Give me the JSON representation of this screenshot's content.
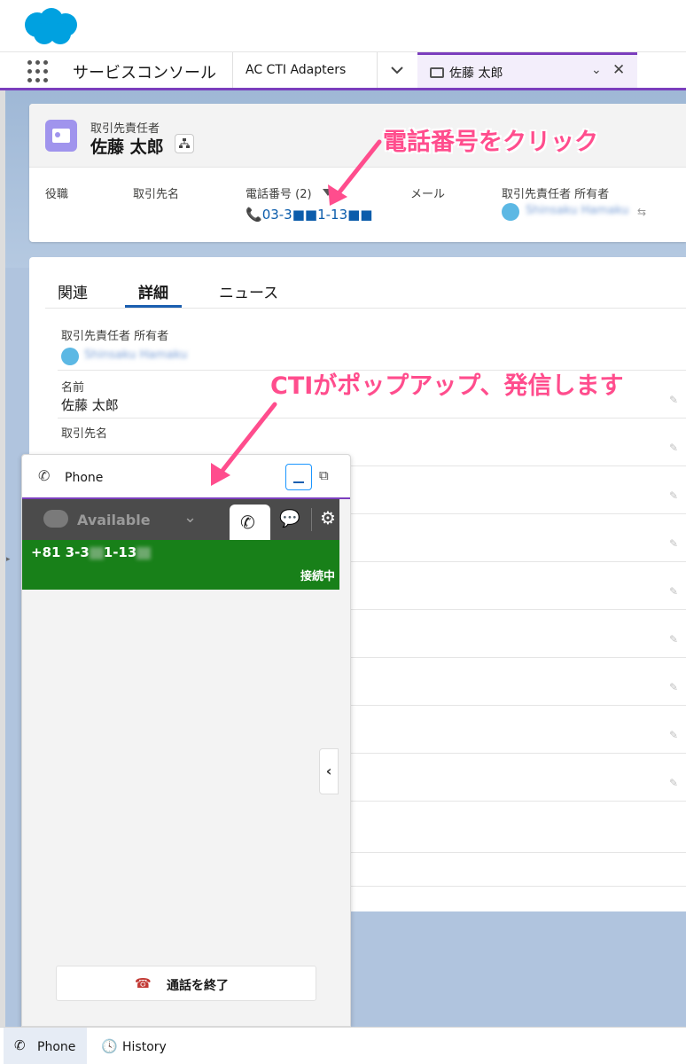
{
  "header": {
    "app_name": "サービスコンソール",
    "tabs": [
      {
        "label": "AC CTI Adapters"
      },
      {
        "label": "佐藤 太郎"
      }
    ]
  },
  "record": {
    "type_label": "取引先責任者",
    "name": "佐藤 太郎",
    "highlights": {
      "title_label": "役職",
      "account_label": "取引先名",
      "phone_label": "電話番号 (2)",
      "phone_value": "03-3■■1-13■■",
      "email_label": "メール",
      "owner_label": "取引先責任者 所有者",
      "owner_value": "Shinsaku Hamaku"
    }
  },
  "detail": {
    "tabs": [
      "関連",
      "詳細",
      "ニュース"
    ],
    "active_tab": "詳細",
    "fields": [
      {
        "label": "取引先責任者 所有者",
        "value": "Shinsaku Hamaku"
      },
      {
        "label": "名前",
        "value": "佐藤 太郎"
      },
      {
        "label": "取引先名",
        "value": ""
      }
    ]
  },
  "phone_panel": {
    "title": "Phone",
    "status": "Available",
    "call_number": "+81 3-3",
    "call_number_mid": "1-13",
    "call_status": "接続中",
    "end_call_label": "通話を終了"
  },
  "utility_bar": {
    "items": [
      {
        "label": "Phone"
      },
      {
        "label": "History"
      }
    ]
  },
  "annotations": {
    "click_phone": "電話番号をクリック",
    "cti_popup": "CTIがポップアップ、発信します"
  },
  "colors": {
    "accent": "#7b3ebd",
    "call_green": "#188019",
    "annotation": "#ff4d8d",
    "link": "#0b5cab"
  }
}
